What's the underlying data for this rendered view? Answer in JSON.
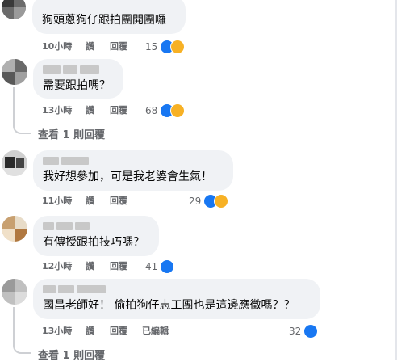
{
  "colors": {
    "like": "#1877f2",
    "haha": "#f7b125",
    "meta": "#65676b",
    "bubble": "#f0f2f5"
  },
  "comments": [
    {
      "text": "狗頭蔥狗仔跟拍團開團囉",
      "time": "10小時",
      "like_label": "讚",
      "reply_label": "回覆",
      "reactions_count": "15",
      "reaction_icons": [
        "like-icon",
        "haha-icon"
      ]
    },
    {
      "text": "需要跟拍嗎？",
      "time": "13小時",
      "like_label": "讚",
      "reply_label": "回覆",
      "reactions_count": "68",
      "reaction_icons": [
        "like-icon",
        "haha-icon"
      ],
      "view_replies": "查看 1 則回覆"
    },
    {
      "text": "我好想參加，可是我老婆會生氣！",
      "time": "11小時",
      "like_label": "讚",
      "reply_label": "回覆",
      "reactions_count": "29",
      "reaction_icons": [
        "like-icon",
        "haha-icon"
      ]
    },
    {
      "text": "有傳授跟拍技巧嗎？",
      "time": "12小時",
      "like_label": "讚",
      "reply_label": "回覆",
      "reactions_count": "41",
      "reaction_icons": [
        "like-icon"
      ]
    },
    {
      "text": "國昌老師好！ 偷拍狗仔志工團也是這邊應徵嗎？？",
      "time": "13小時",
      "like_label": "讚",
      "reply_label": "回覆",
      "edited_label": "已編輯",
      "reactions_count": "32",
      "reaction_icons": [
        "like-icon"
      ],
      "view_replies": "查看 1 則回覆"
    }
  ]
}
